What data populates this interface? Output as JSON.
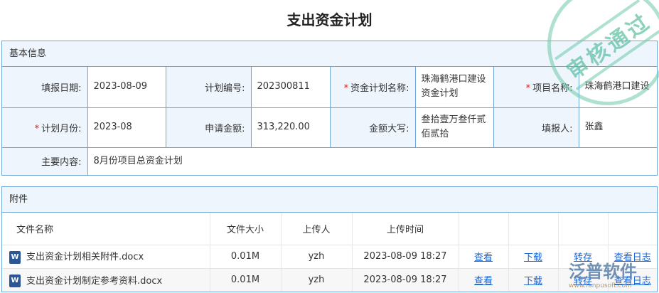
{
  "title": "支出资金计划",
  "stamp": "审核通过",
  "basic": {
    "header": "基本信息",
    "fill_date_label": "填报日期:",
    "fill_date": "2023-08-09",
    "plan_no_label": "计划编号:",
    "plan_no": "202300811",
    "plan_name_label": "资金计划名称:",
    "plan_name": "珠海鹤港口建设资金计划",
    "project_label": "项目名称:",
    "project": "珠海鹤港口建设",
    "month_label": "计划月份:",
    "month": "2023-08",
    "amount_label": "申请金额:",
    "amount": "313,220.00",
    "amount_upper_label": "金额大写:",
    "amount_upper": "叁拾壹万叁仟贰佰贰拾",
    "reporter_label": "填报人:",
    "reporter": "张鑫",
    "content_label": "主要内容:",
    "content": "8月份项目总资金计划",
    "required_mark": "*"
  },
  "attachments": {
    "header": "附件",
    "columns": [
      "文件名称",
      "文件大小",
      "上传人",
      "上传时间"
    ],
    "actions": [
      "查看",
      "下载",
      "转存",
      "查看日志"
    ],
    "file_icon_text": "W",
    "rows": [
      {
        "name": "支出资金计划相关附件.docx",
        "size": "0.01M",
        "uploader": "yzh",
        "time": "2023-08-09 18:27"
      },
      {
        "name": "支出资金计划制定参考资料.docx",
        "size": "0.01M",
        "uploader": "yzh",
        "time": "2023-08-09 18:27"
      }
    ]
  },
  "watermark": {
    "brand": "泛普软件",
    "url": "www.fanpusoft.com"
  }
}
